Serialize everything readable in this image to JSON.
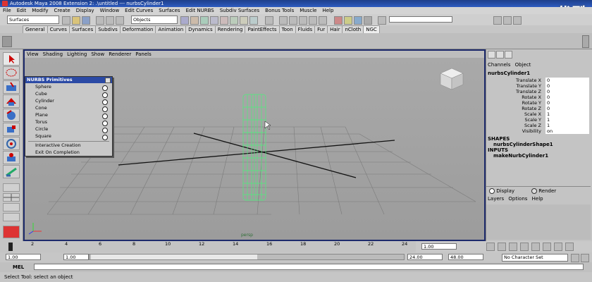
{
  "window": {
    "title": "Autodesk Maya 2008 Extension 2: .\\untitled  ---  nurbsCylinder1",
    "watermark": "优酷"
  },
  "menubar": [
    "File",
    "Edit",
    "Modify",
    "Create",
    "Display",
    "Window",
    "Edit Curves",
    "Surfaces",
    "Edit NURBS",
    "Subdiv Surfaces",
    "Bonus Tools",
    "Muscle",
    "Help"
  ],
  "statusline": {
    "menuset": "Surfaces",
    "selection_mode": "Objects"
  },
  "shelf_tabs": [
    "General",
    "Curves",
    "Surfaces",
    "Subdivs",
    "Deformation",
    "Animation",
    "Dynamics",
    "Rendering",
    "PaintEffects",
    "Toon",
    "Fluids",
    "Fur",
    "Hair",
    "nCloth",
    "NGC"
  ],
  "panel_menu": [
    "View",
    "Shading",
    "Lighting",
    "Show",
    "Renderer",
    "Panels"
  ],
  "viewport": {
    "camera_label": "persp"
  },
  "nurbs_menu": {
    "title": "NURBS Primitives",
    "items": [
      "Sphere",
      "Cube",
      "Cylinder",
      "Cone",
      "Plane",
      "Torus",
      "Circle",
      "Square"
    ],
    "extra": [
      "Interactive Creation",
      "Exit On Completion"
    ]
  },
  "channel_box": {
    "menus": [
      "Channels",
      "Object"
    ],
    "object": "nurbsCylinder1",
    "attributes": [
      {
        "name": "Translate X",
        "value": "0"
      },
      {
        "name": "Translate Y",
        "value": "0"
      },
      {
        "name": "Translate Z",
        "value": "0"
      },
      {
        "name": "Rotate X",
        "value": "0"
      },
      {
        "name": "Rotate Y",
        "value": "0"
      },
      {
        "name": "Rotate Z",
        "value": "0"
      },
      {
        "name": "Scale X",
        "value": "1"
      },
      {
        "name": "Scale Y",
        "value": "1"
      },
      {
        "name": "Scale Z",
        "value": "1"
      },
      {
        "name": "Visibility",
        "value": "on"
      }
    ],
    "shapes_label": "SHAPES",
    "shape": "nurbsCylinderShape1",
    "inputs_label": "INPUTS",
    "input": "makeNurbCylinder1",
    "layer_tabs": [
      "Display",
      "Render"
    ],
    "layer_menus": [
      "Layers",
      "Options",
      "Help"
    ]
  },
  "timeline": {
    "ticks": [
      "2",
      "4",
      "6",
      "8",
      "10",
      "12",
      "14",
      "16",
      "18",
      "20",
      "22",
      "24"
    ],
    "current_frame": "1.00"
  },
  "range": {
    "start": "1.00",
    "inner_start": "1.00",
    "inner_end": "24.00",
    "end_a": "24.00",
    "end_b": "48.00",
    "character_set": "No Character Set"
  },
  "command_line": {
    "label": "MEL"
  },
  "help_line": {
    "text": "Select Tool: select an object"
  }
}
